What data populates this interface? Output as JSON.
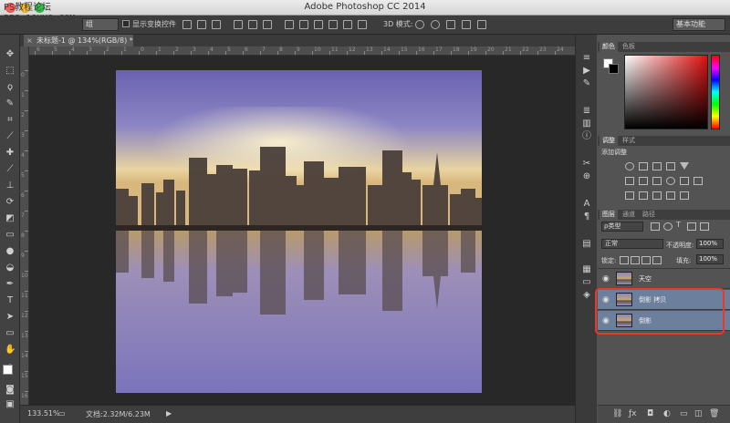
{
  "window": {
    "title": "Adobe Photoshop CC 2014",
    "watermark_line1": "PS教程论坛",
    "watermark_line2": "BBS.16XX8.COM"
  },
  "options_bar": {
    "layer_select": "组",
    "show_transform_label": "显示变换控件",
    "mode_3d_label": "3D 模式:",
    "workspace": "基本功能"
  },
  "document": {
    "tab_label": "未标题-1 @ 134%(RGB/8) *"
  },
  "ruler": {
    "h_numbers": [
      "6",
      "5",
      "4",
      "3",
      "2",
      "1",
      "0",
      "1",
      "2",
      "3",
      "4",
      "5",
      "6",
      "7",
      "8",
      "9",
      "10",
      "11",
      "12",
      "13",
      "14",
      "15",
      "16",
      "17",
      "18",
      "19",
      "20",
      "21",
      "22",
      "23",
      "24"
    ],
    "v_numbers": [
      "0",
      "1",
      "2",
      "3",
      "4",
      "5",
      "6",
      "7",
      "8",
      "9",
      "10",
      "11",
      "12",
      "13",
      "14",
      "15",
      "16"
    ]
  },
  "status": {
    "zoom": "133.51%",
    "doc_size": "文档:2.32M/6.23M"
  },
  "panels": {
    "color_tabs": [
      "颜色",
      "色板"
    ],
    "adjust_tabs": [
      "调整",
      "样式"
    ],
    "adjust_title": "添加调整",
    "layer_tabs": [
      "图层",
      "通道",
      "路径"
    ],
    "filter_kind": "ρ类型",
    "blend_mode": "正常",
    "opacity_label": "不透明度:",
    "opacity_value": "100%",
    "lock_label": "锁定:",
    "fill_label": "填充:",
    "fill_value": "100%",
    "layers": [
      {
        "name": "天空",
        "selected": false
      },
      {
        "name": "倒影 拷贝",
        "selected": true
      },
      {
        "name": "倒影",
        "selected": true
      }
    ]
  },
  "colors": {
    "highlight": "#e8392b",
    "selected_layer": "#6c7f9c"
  }
}
